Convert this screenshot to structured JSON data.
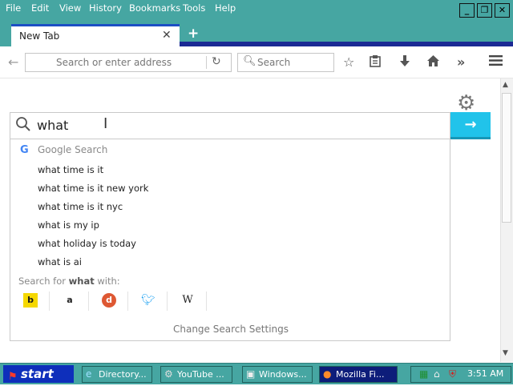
{
  "menu": [
    "File",
    "Edit",
    "View",
    "History",
    "Bookmarks",
    "Tools",
    "Help"
  ],
  "window_controls": {
    "minimize": "_",
    "restore": "❐",
    "close": "✕"
  },
  "tab": {
    "title": "New Tab",
    "close": "✕",
    "new_tab": "+"
  },
  "navbar": {
    "url_placeholder": "Search or enter address",
    "search_placeholder": "Search"
  },
  "main_search": {
    "value": "what",
    "go": "→"
  },
  "dropdown": {
    "engine": "Google Search",
    "suggestions": [
      "what time is it",
      "what time is it new york",
      "what time is it nyc",
      "what is my ip",
      "what holiday is today",
      "what is ai"
    ],
    "search_for_prefix": "Search for",
    "search_for_term": "what",
    "search_for_suffix": "with:",
    "engines": [
      "Bing",
      "Amazon",
      "DuckDuckGo",
      "Twitter",
      "Wikipedia"
    ],
    "change_settings": "Change Search Settings"
  },
  "taskbar": {
    "start": "start",
    "tasks": [
      "Directory...",
      "YouTube ...",
      "Windows...",
      "Mozilla Fi..."
    ],
    "clock": "3:51 AM"
  },
  "colors": {
    "chrome_teal": "#46a6a2",
    "tab_accent": "#1c4fc4",
    "go_button": "#21c3ea",
    "start_blue": "#0e2fbb"
  }
}
